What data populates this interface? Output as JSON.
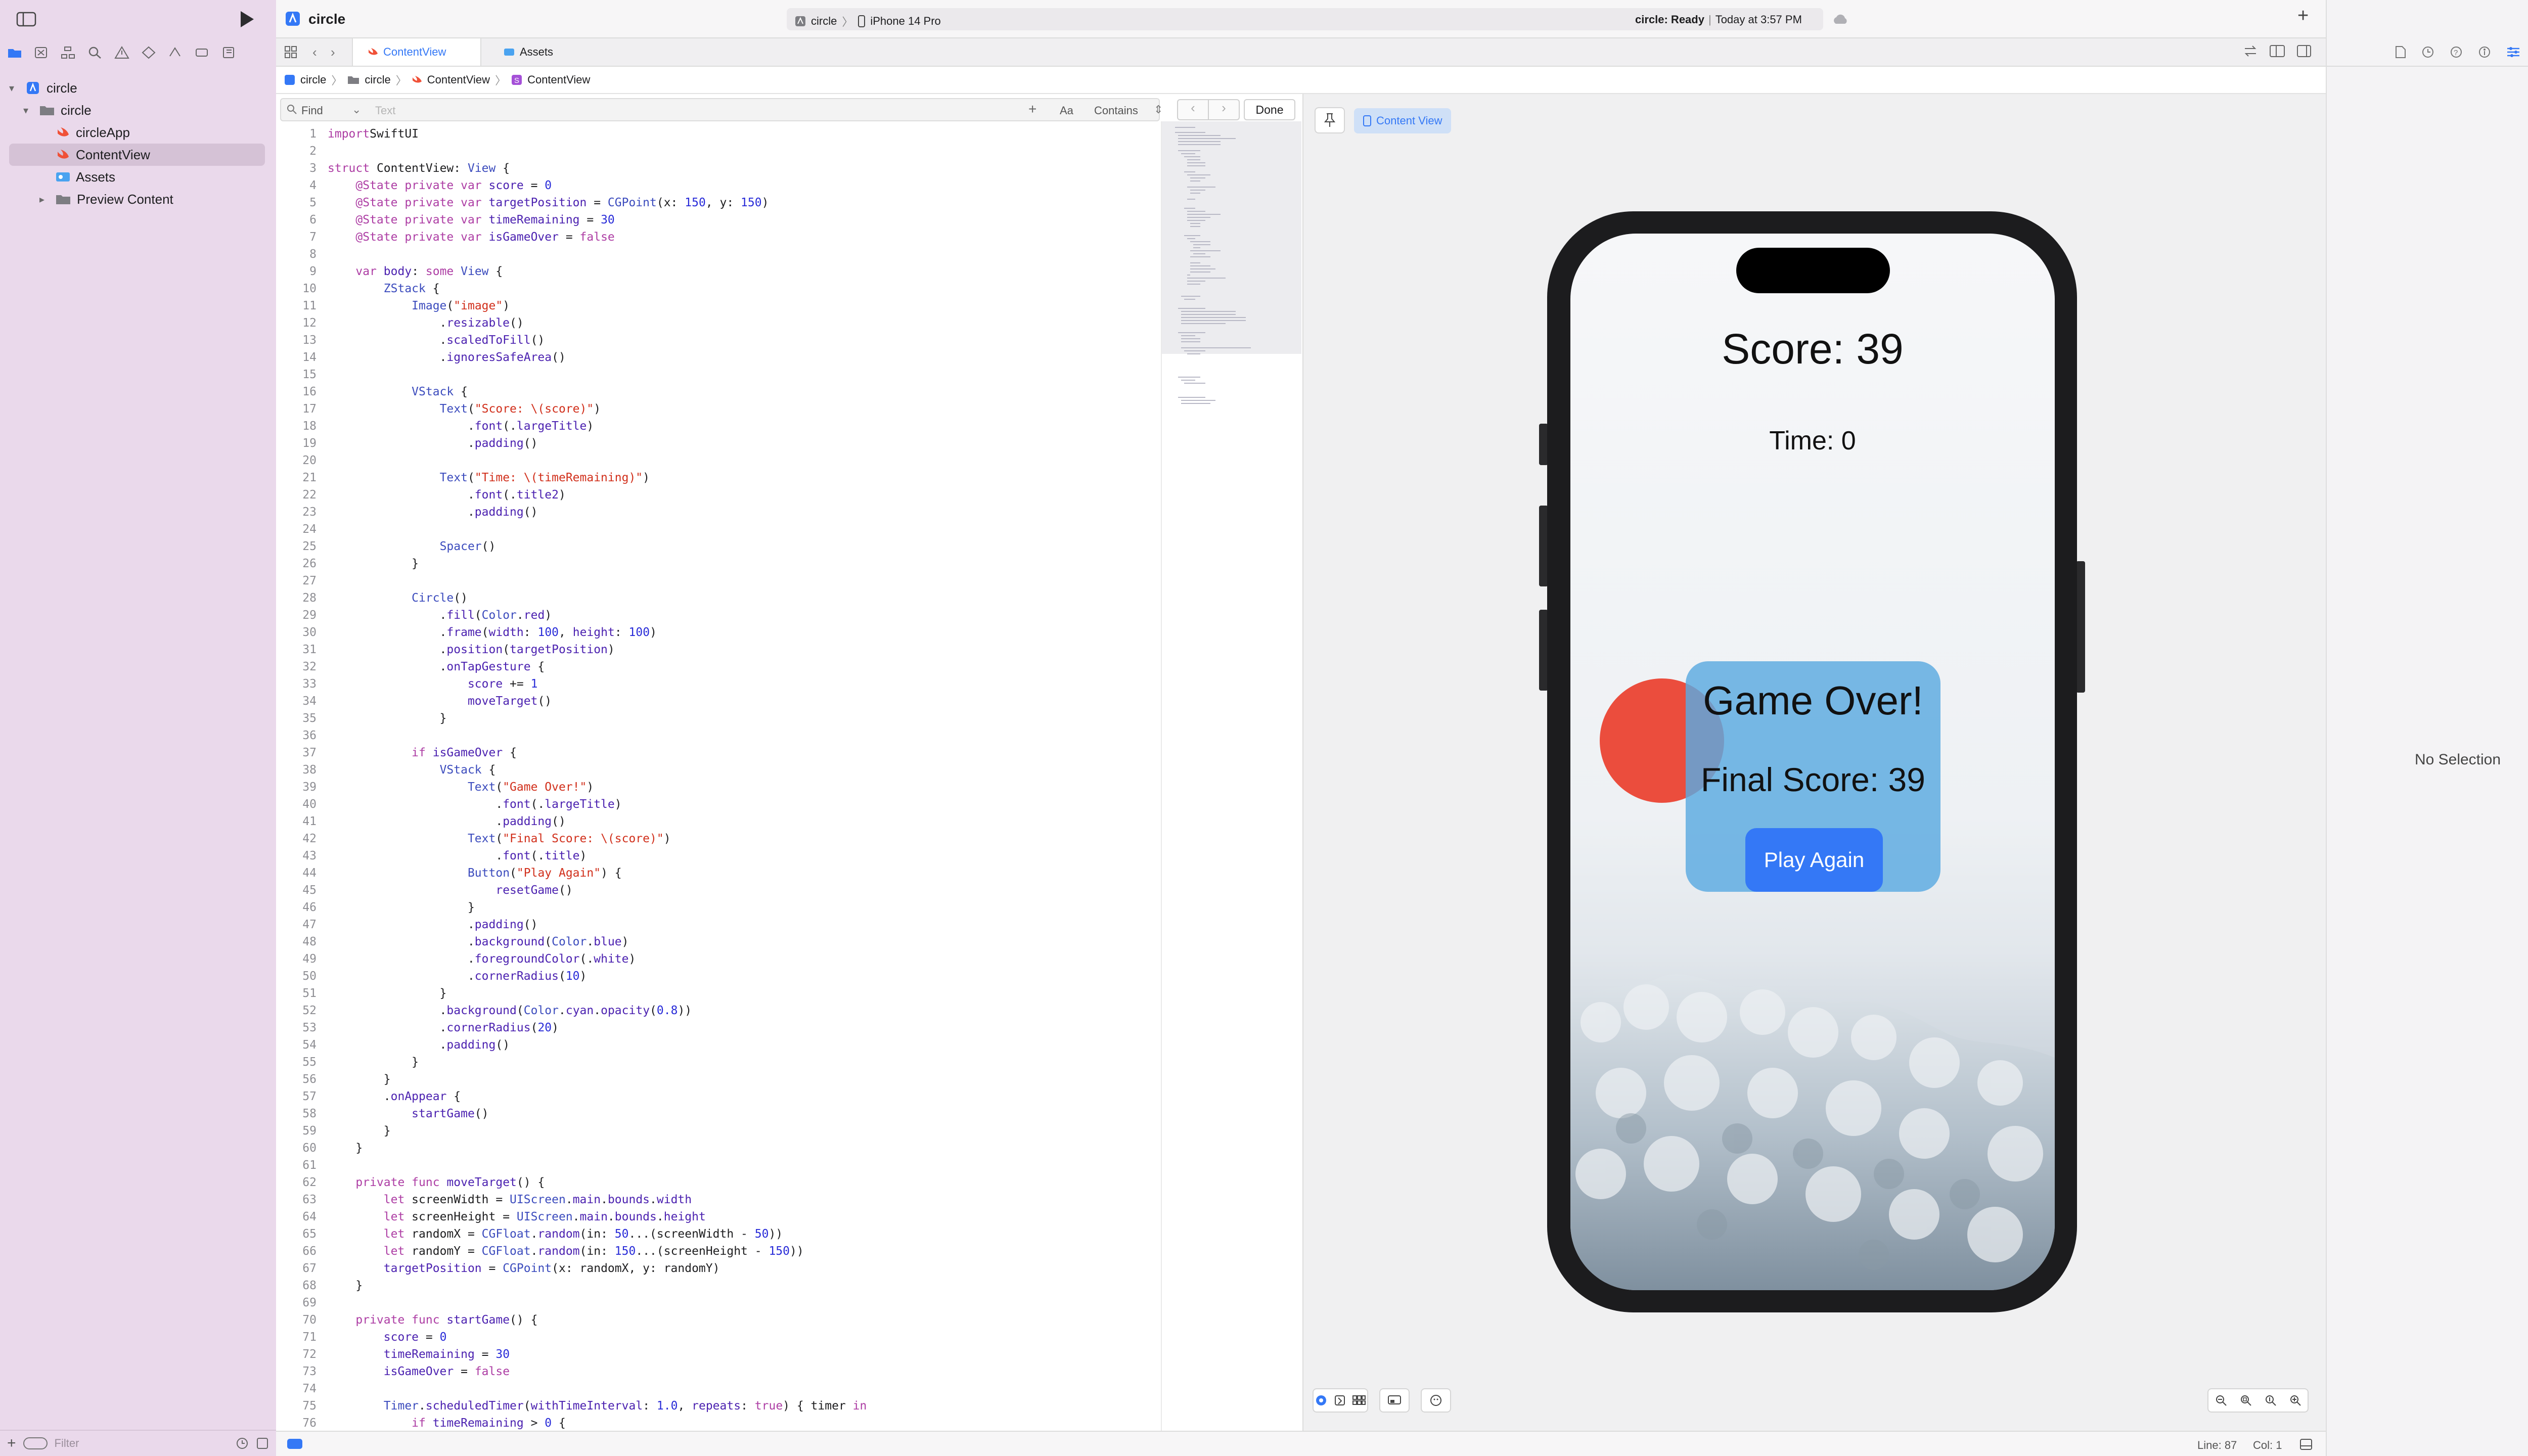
{
  "toolbar": {
    "project_name": "circle",
    "scheme_project": "circle",
    "scheme_device": "iPhone 14 Pro",
    "status": "circle: Ready",
    "status_time": "Today at 3:57 PM"
  },
  "navigator": {
    "items": [
      {
        "label": "circle",
        "level": 0,
        "kind": "project"
      },
      {
        "label": "circle",
        "level": 1,
        "kind": "folder"
      },
      {
        "label": "circleApp",
        "level": 2,
        "kind": "swift"
      },
      {
        "label": "ContentView",
        "level": 2,
        "kind": "swift",
        "selected": true
      },
      {
        "label": "Assets",
        "level": 2,
        "kind": "assets"
      },
      {
        "label": "Preview Content",
        "level": 2,
        "kind": "folder"
      }
    ],
    "filter_placeholder": "Filter"
  },
  "tabs": [
    {
      "label": "ContentView",
      "active": true
    },
    {
      "label": "Assets",
      "active": false
    }
  ],
  "breadcrumb": [
    "circle",
    "circle",
    "ContentView",
    "ContentView"
  ],
  "find": {
    "mode": "Find",
    "placeholder": "Text",
    "case_label": "Aa",
    "match_label": "Contains",
    "done_label": "Done"
  },
  "code_lines": [
    [
      [
        "kw",
        "import"
      ],
      [
        "",
        "SwiftUI"
      ]
    ],
    [],
    [
      [
        "kw",
        "struct"
      ],
      [
        "",
        " ContentView: "
      ],
      [
        "ty",
        "View"
      ],
      [
        "",
        " {"
      ]
    ],
    [
      [
        "",
        "    "
      ],
      [
        "kw",
        "@State private var"
      ],
      [
        "",
        " "
      ],
      [
        "fn",
        "score"
      ],
      [
        "",
        " = "
      ],
      [
        "nm",
        "0"
      ]
    ],
    [
      [
        "",
        "    "
      ],
      [
        "kw",
        "@State private var"
      ],
      [
        "",
        " "
      ],
      [
        "fn",
        "targetPosition"
      ],
      [
        "",
        " = "
      ],
      [
        "ty",
        "CGPoint"
      ],
      [
        "",
        "(x: "
      ],
      [
        "nm",
        "150"
      ],
      [
        "",
        ", y: "
      ],
      [
        "nm",
        "150"
      ],
      [
        "",
        ")"
      ]
    ],
    [
      [
        "",
        "    "
      ],
      [
        "kw",
        "@State private var"
      ],
      [
        "",
        " "
      ],
      [
        "fn",
        "timeRemaining"
      ],
      [
        "",
        " = "
      ],
      [
        "nm",
        "30"
      ]
    ],
    [
      [
        "",
        "    "
      ],
      [
        "kw",
        "@State private var"
      ],
      [
        "",
        " "
      ],
      [
        "fn",
        "isGameOver"
      ],
      [
        "",
        " = "
      ],
      [
        "kw",
        "false"
      ]
    ],
    [],
    [
      [
        "",
        "    "
      ],
      [
        "kw",
        "var"
      ],
      [
        "",
        " "
      ],
      [
        "fn",
        "body"
      ],
      [
        "",
        ": "
      ],
      [
        "kw",
        "some"
      ],
      [
        "",
        " "
      ],
      [
        "ty",
        "View"
      ],
      [
        "",
        " {"
      ]
    ],
    [
      [
        "",
        "        "
      ],
      [
        "ty",
        "ZStack"
      ],
      [
        "",
        " {"
      ]
    ],
    [
      [
        "",
        "            "
      ],
      [
        "ty",
        "Image"
      ],
      [
        "",
        "("
      ],
      [
        "st",
        "\"image\""
      ],
      [
        "",
        ")"
      ]
    ],
    [
      [
        "",
        "                ."
      ],
      [
        "fn",
        "resizable"
      ],
      [
        "",
        "()"
      ]
    ],
    [
      [
        "",
        "                ."
      ],
      [
        "fn",
        "scaledToFill"
      ],
      [
        "",
        "()"
      ]
    ],
    [
      [
        "",
        "                ."
      ],
      [
        "fn",
        "ignoresSafeArea"
      ],
      [
        "",
        "()"
      ]
    ],
    [],
    [
      [
        "",
        "            "
      ],
      [
        "ty",
        "VStack"
      ],
      [
        "",
        " {"
      ]
    ],
    [
      [
        "",
        "                "
      ],
      [
        "ty",
        "Text"
      ],
      [
        "",
        "("
      ],
      [
        "st",
        "\"Score: \\(score)\""
      ],
      [
        "",
        ")"
      ]
    ],
    [
      [
        "",
        "                    ."
      ],
      [
        "fn",
        "font"
      ],
      [
        "",
        "(."
      ],
      [
        "fn",
        "largeTitle"
      ],
      [
        "",
        ")"
      ]
    ],
    [
      [
        "",
        "                    ."
      ],
      [
        "fn",
        "padding"
      ],
      [
        "",
        "()"
      ]
    ],
    [],
    [
      [
        "",
        "                "
      ],
      [
        "ty",
        "Text"
      ],
      [
        "",
        "("
      ],
      [
        "st",
        "\"Time: \\(timeRemaining)\""
      ],
      [
        "",
        ")"
      ]
    ],
    [
      [
        "",
        "                    ."
      ],
      [
        "fn",
        "font"
      ],
      [
        "",
        "(."
      ],
      [
        "fn",
        "title2"
      ],
      [
        "",
        ")"
      ]
    ],
    [
      [
        "",
        "                    ."
      ],
      [
        "fn",
        "padding"
      ],
      [
        "",
        "()"
      ]
    ],
    [],
    [
      [
        "",
        "                "
      ],
      [
        "ty",
        "Spacer"
      ],
      [
        "",
        "()"
      ]
    ],
    [
      [
        "",
        "            }"
      ]
    ],
    [],
    [
      [
        "",
        "            "
      ],
      [
        "ty",
        "Circle"
      ],
      [
        "",
        "()"
      ]
    ],
    [
      [
        "",
        "                ."
      ],
      [
        "fn",
        "fill"
      ],
      [
        "",
        "("
      ],
      [
        "ty",
        "Color"
      ],
      [
        "",
        "."
      ],
      [
        "fn",
        "red"
      ],
      [
        "",
        ")"
      ]
    ],
    [
      [
        "",
        "                ."
      ],
      [
        "fn",
        "frame"
      ],
      [
        "",
        "("
      ],
      [
        "fn",
        "width"
      ],
      [
        "",
        ": "
      ],
      [
        "nm",
        "100"
      ],
      [
        "",
        ", "
      ],
      [
        "fn",
        "height"
      ],
      [
        "",
        ": "
      ],
      [
        "nm",
        "100"
      ],
      [
        "",
        ")"
      ]
    ],
    [
      [
        "",
        "                ."
      ],
      [
        "fn",
        "position"
      ],
      [
        "",
        "("
      ],
      [
        "fn",
        "targetPosition"
      ],
      [
        "",
        ")"
      ]
    ],
    [
      [
        "",
        "                ."
      ],
      [
        "fn",
        "onTapGesture"
      ],
      [
        "",
        " {"
      ]
    ],
    [
      [
        "",
        "                    "
      ],
      [
        "fn",
        "score"
      ],
      [
        "",
        " += "
      ],
      [
        "nm",
        "1"
      ]
    ],
    [
      [
        "",
        "                    "
      ],
      [
        "fn",
        "moveTarget"
      ],
      [
        "",
        "()"
      ]
    ],
    [
      [
        "",
        "                }"
      ]
    ],
    [],
    [
      [
        "",
        "            "
      ],
      [
        "kw",
        "if"
      ],
      [
        "",
        " "
      ],
      [
        "fn",
        "isGameOver"
      ],
      [
        "",
        " {"
      ]
    ],
    [
      [
        "",
        "                "
      ],
      [
        "ty",
        "VStack"
      ],
      [
        "",
        " {"
      ]
    ],
    [
      [
        "",
        "                    "
      ],
      [
        "ty",
        "Text"
      ],
      [
        "",
        "("
      ],
      [
        "st",
        "\"Game Over!\""
      ],
      [
        "",
        ")"
      ]
    ],
    [
      [
        "",
        "                        ."
      ],
      [
        "fn",
        "font"
      ],
      [
        "",
        "(."
      ],
      [
        "fn",
        "largeTitle"
      ],
      [
        "",
        ")"
      ]
    ],
    [
      [
        "",
        "                        ."
      ],
      [
        "fn",
        "padding"
      ],
      [
        "",
        "()"
      ]
    ],
    [
      [
        "",
        "                    "
      ],
      [
        "ty",
        "Text"
      ],
      [
        "",
        "("
      ],
      [
        "st",
        "\"Final Score: \\(score)\""
      ],
      [
        "",
        ")"
      ]
    ],
    [
      [
        "",
        "                        ."
      ],
      [
        "fn",
        "font"
      ],
      [
        "",
        "(."
      ],
      [
        "fn",
        "title"
      ],
      [
        "",
        ")"
      ]
    ],
    [
      [
        "",
        "                    "
      ],
      [
        "ty",
        "Button"
      ],
      [
        "",
        "("
      ],
      [
        "st",
        "\"Play Again\""
      ],
      [
        "",
        ") {"
      ]
    ],
    [
      [
        "",
        "                        "
      ],
      [
        "fn",
        "resetGame"
      ],
      [
        "",
        "()"
      ]
    ],
    [
      [
        "",
        "                    }"
      ]
    ],
    [
      [
        "",
        "                    ."
      ],
      [
        "fn",
        "padding"
      ],
      [
        "",
        "()"
      ]
    ],
    [
      [
        "",
        "                    ."
      ],
      [
        "fn",
        "background"
      ],
      [
        "",
        "("
      ],
      [
        "ty",
        "Color"
      ],
      [
        "",
        "."
      ],
      [
        "fn",
        "blue"
      ],
      [
        "",
        ")"
      ]
    ],
    [
      [
        "",
        "                    ."
      ],
      [
        "fn",
        "foregroundColor"
      ],
      [
        "",
        "(."
      ],
      [
        "fn",
        "white"
      ],
      [
        "",
        ")"
      ]
    ],
    [
      [
        "",
        "                    ."
      ],
      [
        "fn",
        "cornerRadius"
      ],
      [
        "",
        "("
      ],
      [
        "nm",
        "10"
      ],
      [
        "",
        ")"
      ]
    ],
    [
      [
        "",
        "                }"
      ]
    ],
    [
      [
        "",
        "                ."
      ],
      [
        "fn",
        "background"
      ],
      [
        "",
        "("
      ],
      [
        "ty",
        "Color"
      ],
      [
        "",
        "."
      ],
      [
        "fn",
        "cyan"
      ],
      [
        "",
        "."
      ],
      [
        "fn",
        "opacity"
      ],
      [
        "",
        "("
      ],
      [
        "nm",
        "0.8"
      ],
      [
        "",
        "))"
      ]
    ],
    [
      [
        "",
        "                ."
      ],
      [
        "fn",
        "cornerRadius"
      ],
      [
        "",
        "("
      ],
      [
        "nm",
        "20"
      ],
      [
        "",
        ")"
      ]
    ],
    [
      [
        "",
        "                ."
      ],
      [
        "fn",
        "padding"
      ],
      [
        "",
        "()"
      ]
    ],
    [
      [
        "",
        "            }"
      ]
    ],
    [
      [
        "",
        "        }"
      ]
    ],
    [
      [
        "",
        "        ."
      ],
      [
        "fn",
        "onAppear"
      ],
      [
        "",
        " {"
      ]
    ],
    [
      [
        "",
        "            "
      ],
      [
        "fn",
        "startGame"
      ],
      [
        "",
        "()"
      ]
    ],
    [
      [
        "",
        "        }"
      ]
    ],
    [
      [
        "",
        "    }"
      ]
    ],
    [],
    [
      [
        "",
        "    "
      ],
      [
        "kw",
        "private func"
      ],
      [
        "",
        " "
      ],
      [
        "fn",
        "moveTarget"
      ],
      [
        "",
        "() {"
      ]
    ],
    [
      [
        "",
        "        "
      ],
      [
        "kw",
        "let"
      ],
      [
        "",
        " screenWidth = "
      ],
      [
        "ty",
        "UIScreen"
      ],
      [
        "",
        "."
      ],
      [
        "fn",
        "main"
      ],
      [
        "",
        "."
      ],
      [
        "fn",
        "bounds"
      ],
      [
        "",
        "."
      ],
      [
        "fn",
        "width"
      ]
    ],
    [
      [
        "",
        "        "
      ],
      [
        "kw",
        "let"
      ],
      [
        "",
        " screenHeight = "
      ],
      [
        "ty",
        "UIScreen"
      ],
      [
        "",
        "."
      ],
      [
        "fn",
        "main"
      ],
      [
        "",
        "."
      ],
      [
        "fn",
        "bounds"
      ],
      [
        "",
        "."
      ],
      [
        "fn",
        "height"
      ]
    ],
    [
      [
        "",
        "        "
      ],
      [
        "kw",
        "let"
      ],
      [
        "",
        " randomX = "
      ],
      [
        "ty",
        "CGFloat"
      ],
      [
        "",
        "."
      ],
      [
        "fn",
        "random"
      ],
      [
        "",
        "(in: "
      ],
      [
        "nm",
        "50"
      ],
      [
        "",
        "...(screenWidth - "
      ],
      [
        "nm",
        "50"
      ],
      [
        "",
        "))"
      ]
    ],
    [
      [
        "",
        "        "
      ],
      [
        "kw",
        "let"
      ],
      [
        "",
        " randomY = "
      ],
      [
        "ty",
        "CGFloat"
      ],
      [
        "",
        "."
      ],
      [
        "fn",
        "random"
      ],
      [
        "",
        "(in: "
      ],
      [
        "nm",
        "150"
      ],
      [
        "",
        "...(screenHeight - "
      ],
      [
        "nm",
        "150"
      ],
      [
        "",
        "))"
      ]
    ],
    [
      [
        "",
        "        "
      ],
      [
        "fn",
        "targetPosition"
      ],
      [
        "",
        " = "
      ],
      [
        "ty",
        "CGPoint"
      ],
      [
        "",
        "(x: randomX, y: randomY)"
      ]
    ],
    [
      [
        "",
        "    }"
      ]
    ],
    [],
    [
      [
        "",
        "    "
      ],
      [
        "kw",
        "private func"
      ],
      [
        "",
        " "
      ],
      [
        "fn",
        "startGame"
      ],
      [
        "",
        "() {"
      ]
    ],
    [
      [
        "",
        "        "
      ],
      [
        "fn",
        "score"
      ],
      [
        "",
        " = "
      ],
      [
        "nm",
        "0"
      ]
    ],
    [
      [
        "",
        "        "
      ],
      [
        "fn",
        "timeRemaining"
      ],
      [
        "",
        " = "
      ],
      [
        "nm",
        "30"
      ]
    ],
    [
      [
        "",
        "        "
      ],
      [
        "fn",
        "isGameOver"
      ],
      [
        "",
        " = "
      ],
      [
        "kw",
        "false"
      ]
    ],
    [],
    [
      [
        "",
        "        "
      ],
      [
        "ty",
        "Timer"
      ],
      [
        "",
        "."
      ],
      [
        "fn",
        "scheduledTimer"
      ],
      [
        "",
        "("
      ],
      [
        "fn",
        "withTimeInterval"
      ],
      [
        "",
        ": "
      ],
      [
        "nm",
        "1.0"
      ],
      [
        "",
        ", "
      ],
      [
        "fn",
        "repeats"
      ],
      [
        "",
        ": "
      ],
      [
        "kw",
        "true"
      ],
      [
        "",
        ") { timer "
      ],
      [
        "kw",
        "in"
      ]
    ],
    [
      [
        "",
        "            "
      ],
      [
        "kw",
        "if"
      ],
      [
        "",
        " "
      ],
      [
        "fn",
        "timeRemaining"
      ],
      [
        "",
        " > "
      ],
      [
        "nm",
        "0"
      ],
      [
        "",
        " {"
      ]
    ]
  ],
  "preview": {
    "chip_label": "Content View",
    "score_text": "Score: 39",
    "time_text": "Time: 0",
    "game_over_text": "Game Over!",
    "final_score_text": "Final Score: 39",
    "play_again_label": "Play Again"
  },
  "inspector": {
    "empty_text": "No Selection"
  },
  "status_bar": {
    "line": "Line: 87",
    "col": "Col: 1"
  },
  "colors": {
    "accent": "#3478f6",
    "circle": "#eb4d3d",
    "overlay": "#6fb7e6",
    "button": "#3478f6"
  }
}
